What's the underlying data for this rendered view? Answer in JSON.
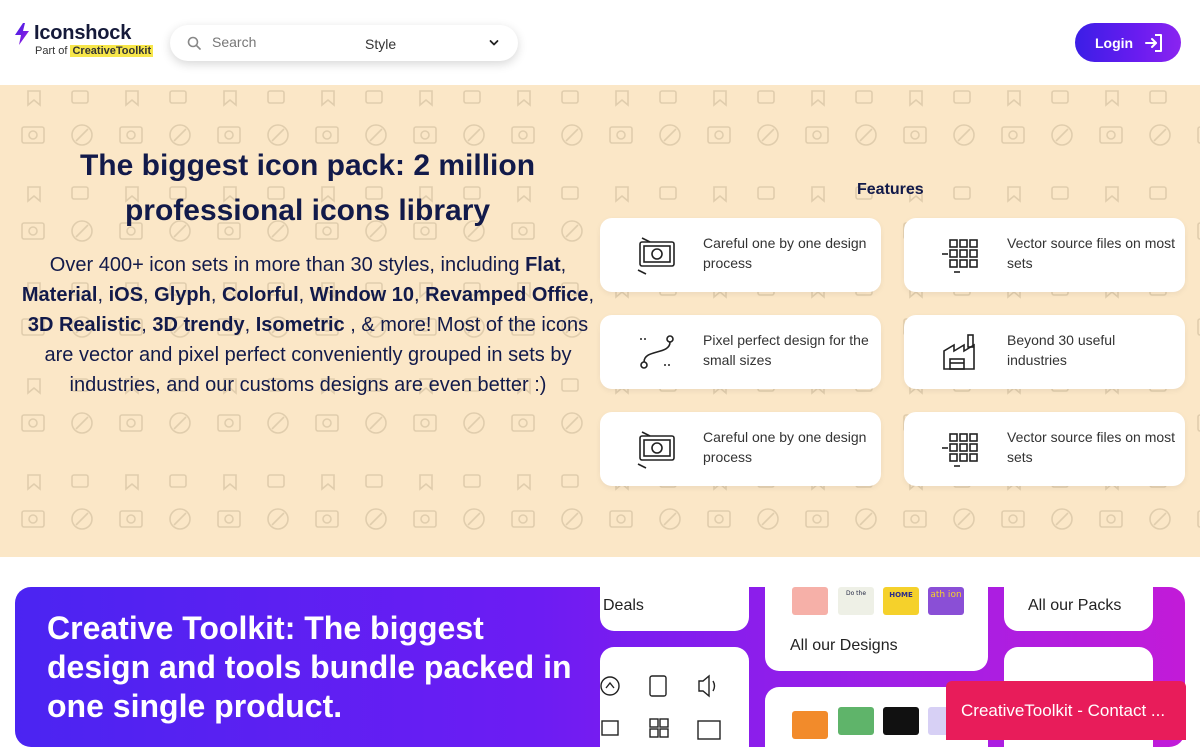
{
  "header": {
    "logo_name": "Iconshock",
    "logo_sub_prefix": "Part of",
    "logo_sub_brand": "CreativeToolkit",
    "search_placeholder": "Search",
    "style_label": "Style",
    "login_label": "Login"
  },
  "hero": {
    "title": "The biggest icon pack: 2 million professional icons library",
    "description": {
      "part1": "Over 400+ icon sets in more than 30 styles, including ",
      "flat": "Flat",
      "material": "Material",
      "ios": "iOS",
      "glyph": "Glyph",
      "colorful": "Colorful",
      "window10": "Window 10",
      "revamped": "Revamped Office",
      "realistic": "3D Realistic",
      "trendy": "3D trendy",
      "isometric": "Isometric",
      "part2": " , & more! Most of the icons are vector and pixel perfect conveniently grouped in sets by industries, and our customs designs are even better :)"
    },
    "features_label": "Features",
    "features": [
      {
        "text": "Careful one by one design process",
        "icon": "photo-frame-icon"
      },
      {
        "text": "Vector source files on most sets",
        "icon": "grid-vector-icon"
      },
      {
        "text": "Pixel perfect design for the small sizes",
        "icon": "bezier-curve-icon"
      },
      {
        "text": "Beyond 30 useful industries",
        "icon": "factory-icon"
      },
      {
        "text": "Careful one by one design process",
        "icon": "photo-frame-icon"
      },
      {
        "text": "Vector source files on most sets",
        "icon": "grid-vector-icon"
      }
    ]
  },
  "banner": {
    "title": "Creative Toolkit: The biggest design and tools bundle packed in one single product.",
    "deals_label": "Deals",
    "designs_label": "All our Designs",
    "packs_label": "All our Packs",
    "thumb_texts": [
      "Do the",
      "HOME",
      "ath ion"
    ]
  },
  "toast": {
    "label": "CreativeToolkit - Contact ..."
  },
  "colors": {
    "hero_bg": "#fbe7c7",
    "login_gradient_start": "#3b1ee6",
    "login_gradient_end": "#8a24f0",
    "toast_bg": "#e81c5a",
    "title_color": "#121a4a"
  }
}
